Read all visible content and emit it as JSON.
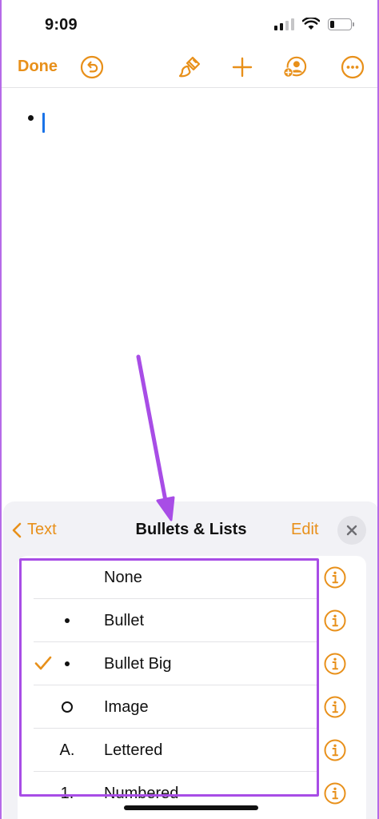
{
  "status_bar": {
    "time": "9:09"
  },
  "toolbar": {
    "done_label": "Done"
  },
  "panel": {
    "back_label": "Text",
    "title": "Bullets & Lists",
    "edit_label": "Edit"
  },
  "list": {
    "items": [
      {
        "label": "None",
        "marker": "",
        "selected": false
      },
      {
        "label": "Bullet",
        "marker": "bullet-dot",
        "selected": false
      },
      {
        "label": "Bullet Big",
        "marker": "bullet-dot",
        "selected": true
      },
      {
        "label": "Image",
        "marker": "ring",
        "selected": false
      },
      {
        "label": "Lettered",
        "marker": "A.",
        "selected": false
      },
      {
        "label": "Numbered",
        "marker": "1.",
        "selected": false
      }
    ]
  },
  "colors": {
    "accent": "#e8901a",
    "annotation": "#a84de6",
    "cursor": "#1a73e8"
  },
  "icons": [
    "undo-icon",
    "brush-icon",
    "plus-icon",
    "collaborate-icon",
    "more-icon",
    "chevron-left-icon",
    "close-icon",
    "checkmark-icon",
    "info-icon"
  ]
}
